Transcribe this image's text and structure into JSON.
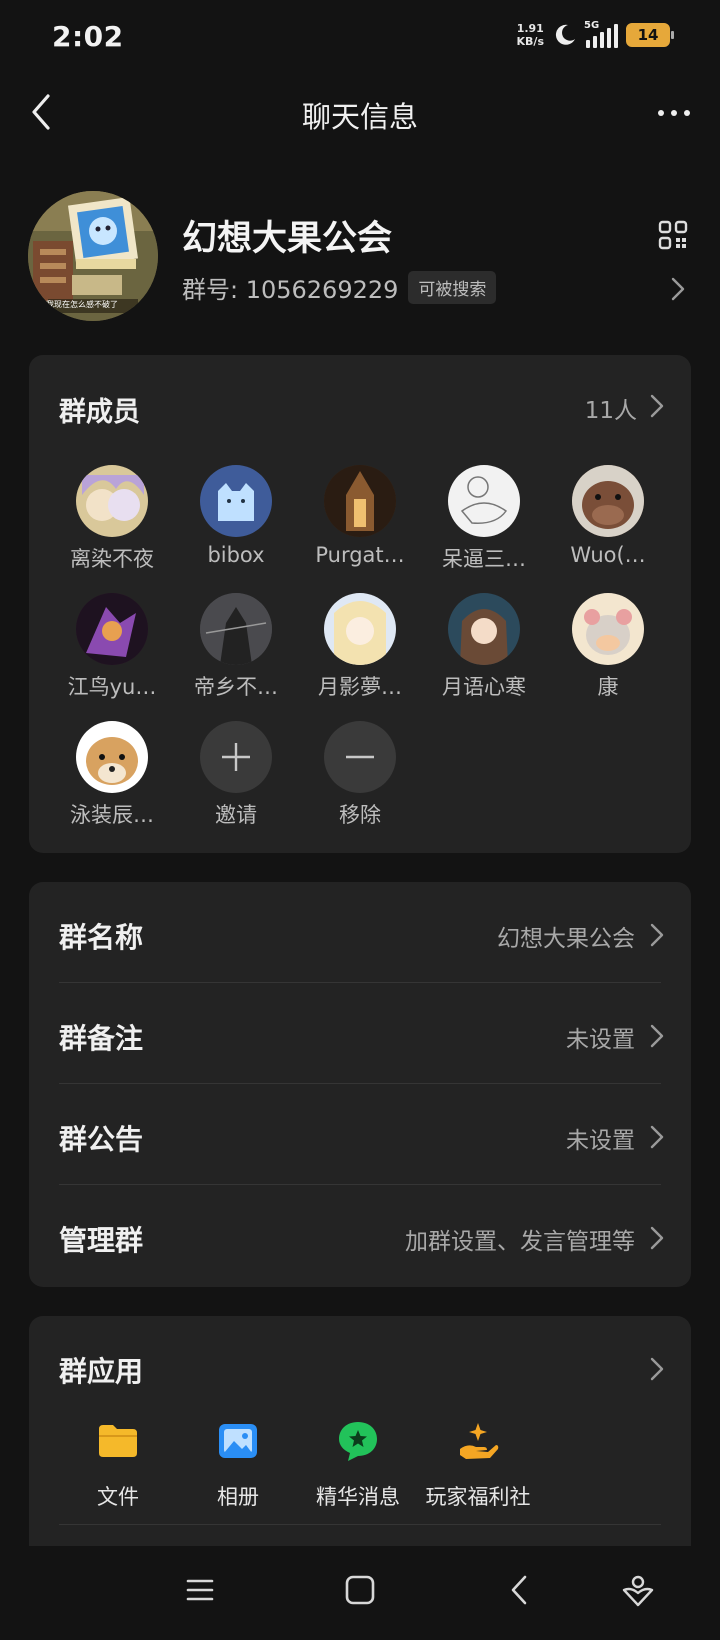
{
  "status_bar": {
    "time": "2:02",
    "net_speed_value": "1.91",
    "net_speed_unit": "KB/s",
    "network": "5G",
    "battery": "14"
  },
  "nav": {
    "title": "聊天信息",
    "back_icon": "chevron-left-icon",
    "more_icon": "more-dots-icon"
  },
  "group": {
    "name": "幻想大果公会",
    "id_label": "群号: 1056269229",
    "searchable": "可被搜索",
    "qr_icon": "qr-code-icon",
    "avatar_caption": "我现在怎么感不破了"
  },
  "members": {
    "title": "群成员",
    "count": "11人",
    "list": [
      {
        "name": "离染不夜",
        "color": "#d9c89a"
      },
      {
        "name": "bibox",
        "color": "#3f5c9a"
      },
      {
        "name": "Purgat…",
        "color": "#4a3420"
      },
      {
        "name": "呆逼三…",
        "color": "#f2f2f2"
      },
      {
        "name": "Wuo(…",
        "color": "#6e4a36"
      },
      {
        "name": "江鸟yu…",
        "color": "#3a2030"
      },
      {
        "name": "帝乡不…",
        "color": "#3c3c3e"
      },
      {
        "name": "月影夢…",
        "color": "#dfe8f4"
      },
      {
        "name": "月语心寒",
        "color": "#2c4a5c"
      },
      {
        "name": "康",
        "color": "#f3e6cf"
      },
      {
        "name": "泳装辰…",
        "color": "#d8a260"
      }
    ],
    "invite_label": "邀请",
    "remove_label": "移除"
  },
  "settings": [
    {
      "label": "群名称",
      "value": "幻想大果公会"
    },
    {
      "label": "群备注",
      "value": "未设置"
    },
    {
      "label": "群公告",
      "value": "未设置"
    },
    {
      "label": "管理群",
      "value": "加群设置、发言管理等"
    }
  ],
  "apps": {
    "title": "群应用",
    "items": [
      {
        "label": "文件",
        "icon": "folder-icon",
        "color": "#f5b92a"
      },
      {
        "label": "相册",
        "icon": "photo-album-icon",
        "color": "#2a8ef5"
      },
      {
        "label": "精华消息",
        "icon": "star-message-icon",
        "color": "#22c25a"
      },
      {
        "label": "玩家福利社",
        "icon": "gift-hand-icon",
        "color": "#f5a623"
      }
    ]
  },
  "navbar": {
    "menu_icon": "menu-icon",
    "home_icon": "home-square-icon",
    "back_icon": "back-icon",
    "assist_icon": "assistant-icon"
  }
}
